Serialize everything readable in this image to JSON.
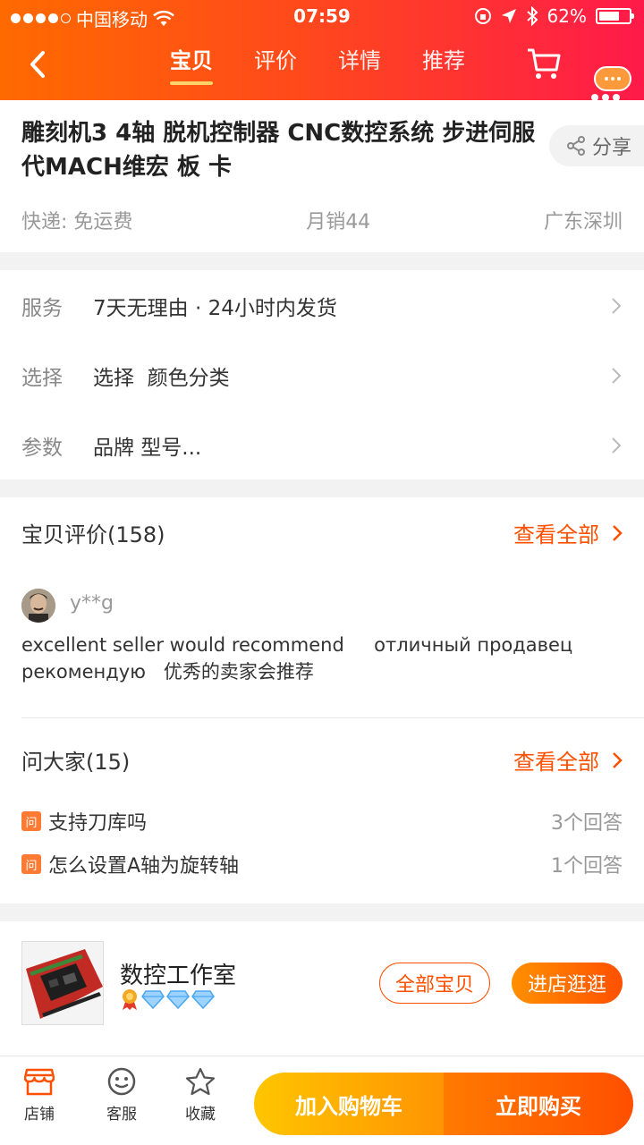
{
  "status_bar": {
    "carrier": "中国移动",
    "time": "07:59",
    "battery": "62%"
  },
  "nav": {
    "tabs": [
      {
        "label": "宝贝"
      },
      {
        "label": "评价"
      },
      {
        "label": "详情"
      },
      {
        "label": "推荐"
      }
    ],
    "active_tab": "宝贝"
  },
  "product": {
    "title": "雕刻机3 4轴 脱机控制器 CNC数控系统 步进伺服 代MACH维宏 板 卡",
    "share_label": "分享",
    "shipping": "快递: 免运费",
    "monthly_sales": "月销44",
    "location": "广东深圳"
  },
  "info": {
    "service_label": "服务",
    "service_value": "7天无理由 · 24小时内发货",
    "choose_label": "选择",
    "choose_value": "选择  颜色分类",
    "params_label": "参数",
    "params_value": "品牌 型号..."
  },
  "reviews": {
    "heading": "宝贝评价(158)",
    "see_all": "查看全部",
    "reviewer": "y**g",
    "text": "excellent seller would recommend     отличный продавец рекомендую   优秀的卖家会推荐"
  },
  "qa": {
    "heading": "问大家(15)",
    "see_all": "查看全部",
    "icon_char": "问",
    "items": [
      {
        "question": "支持刀库吗",
        "answers": "3个回答"
      },
      {
        "question": "怎么设置A轴为旋转轴",
        "answers": "1个回答"
      }
    ]
  },
  "shop": {
    "name": "数控工作室",
    "all_items": "全部宝贝",
    "enter_shop": "进店逛逛"
  },
  "bottom_bar": {
    "store": "店铺",
    "service": "客服",
    "favorite": "收藏",
    "add_to_cart": "加入购物车",
    "buy_now": "立即购买"
  },
  "colors": {
    "accent": "#ff5000",
    "header_start": "#ff6a00",
    "header_end": "#ff1a4a",
    "cart_button": "#ffb000"
  }
}
